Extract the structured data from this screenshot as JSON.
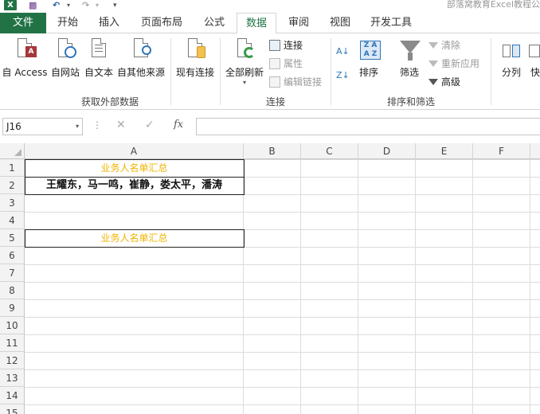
{
  "window": {
    "title": "部落窝教育Excel教程公"
  },
  "tabs": [
    "文件",
    "开始",
    "插入",
    "页面布局",
    "公式",
    "数据",
    "审阅",
    "视图",
    "开发工具"
  ],
  "ribbon": {
    "groups": {
      "get_external": {
        "label": "获取外部数据",
        "buttons": [
          "自 Access",
          "自网站",
          "自文本",
          "自其他来源",
          "现有连接"
        ]
      },
      "connections": {
        "label": "连接",
        "refresh_all": "全部刷新",
        "connections": "连接",
        "properties": "属性",
        "edit_links": "编辑链接"
      },
      "sort_filter": {
        "label": "排序和筛选",
        "sort": "排序",
        "filter": "筛选",
        "clear": "清除",
        "reapply": "重新应用",
        "advanced": "高级"
      },
      "data_tools": {
        "text_to_columns": "分列",
        "flash_fill": "快"
      }
    }
  },
  "formula_bar": {
    "name_box": "J16",
    "fx": "fx",
    "value": ""
  },
  "sheet": {
    "columns": [
      "A",
      "B",
      "C",
      "D",
      "E",
      "F"
    ],
    "rows": [
      "1",
      "2",
      "3",
      "4",
      "5",
      "6",
      "7",
      "8",
      "9",
      "10",
      "11",
      "12",
      "13",
      "14",
      "15"
    ],
    "cells": {
      "A1": "业务人名单汇总",
      "A2": "王耀东，马一鸣，崔静，娄太平，潘涛",
      "A5": "业务人名单汇总"
    }
  },
  "colors": {
    "excel_green": "#217346",
    "title_text": "#f0b400"
  }
}
